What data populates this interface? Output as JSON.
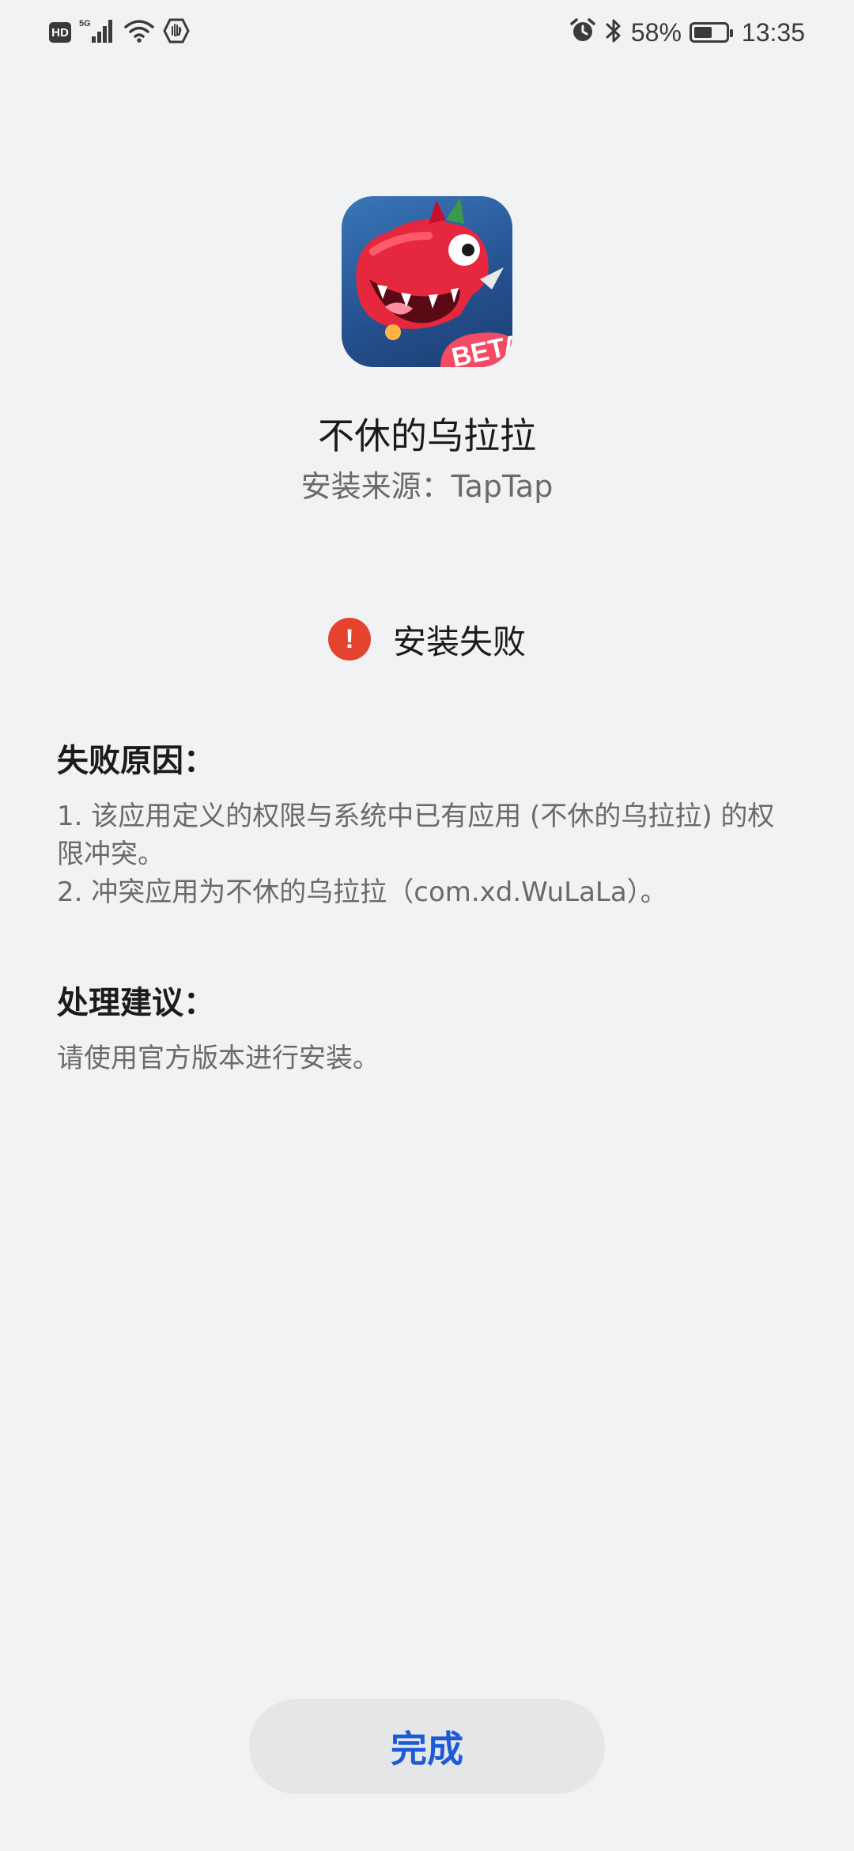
{
  "status_bar": {
    "network_badge": "HD",
    "network_type": "5G",
    "battery_percent": "58%",
    "battery_level": 0.58,
    "time": "13:35",
    "icons": [
      "hd-icon",
      "signal-icon",
      "wifi-icon",
      "hotspot-icon",
      "alarm-icon",
      "bluetooth-icon",
      "battery-icon"
    ]
  },
  "app": {
    "name": "不休的乌拉拉",
    "install_source": "安装来源：TapTap",
    "icon_badge": "BETA"
  },
  "result": {
    "status_text": "安装失败",
    "status_icon": "error-exclamation-icon",
    "status_color": "#e4432d"
  },
  "reason": {
    "title": "失败原因：",
    "lines": [
      "1. 该应用定义的权限与系统中已有应用 (不休的乌拉拉) 的权限冲突。",
      "2. 冲突应用为不休的乌拉拉（com.xd.WuLaLa）。"
    ]
  },
  "suggestion": {
    "title": "处理建议：",
    "text": "请使用官方版本进行安装。"
  },
  "actions": {
    "done_label": "完成",
    "accent_color": "#1d5bd6"
  }
}
